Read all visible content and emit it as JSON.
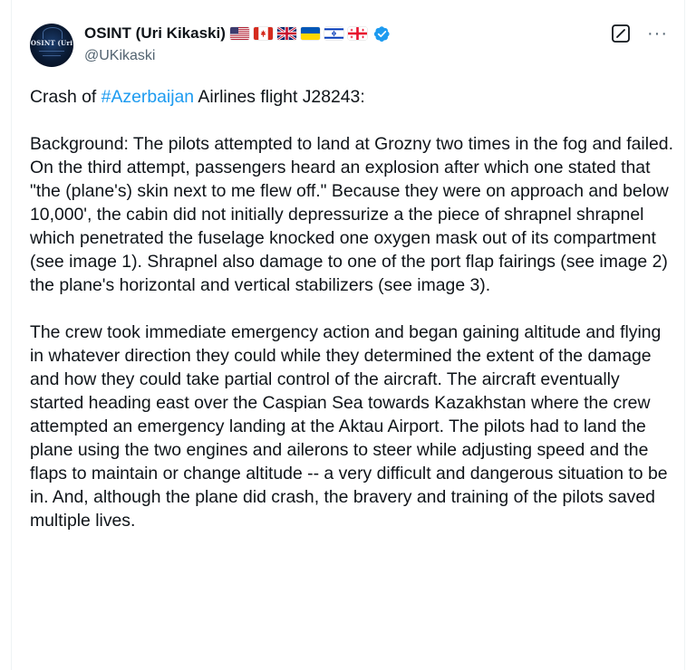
{
  "author": {
    "name": "OSINT (Uri Kikaski)",
    "handle": "@UKikaski",
    "avatar_text": "OSINT (Uri",
    "flags": [
      "us-flag",
      "canada-flag",
      "uk-flag",
      "ukraine-flag",
      "israel-flag",
      "georgia-flag"
    ],
    "verified_icon": "verified-badge-icon"
  },
  "actions": {
    "grok_icon": "grok-icon",
    "more_label": "···"
  },
  "tweet": {
    "p1": {
      "before": "Crash of ",
      "hashtag": "#Azerbaijan",
      "after": " Airlines flight J28243:"
    },
    "p2": "Background: The pilots attempted to land at Grozny two times in the fog and failed. On the third attempt, passengers heard an explosion after which one stated that \"the (plane's) skin next to me flew off.\" Because they were on approach and below 10,000', the cabin did not initially depressurize a the piece of shrapnel shrapnel which penetrated the fuselage knocked one oxygen mask out of its compartment (see image 1). Shrapnel also damage to one of the port flap fairings (see image 2) the plane's horizontal and vertical stabilizers (see image 3).",
    "p3": "The crew took immediate emergency action and began gaining altitude and flying in whatever direction they could while they determined the extent of the damage and how they could take partial control of the aircraft. The aircraft eventually started heading east over the Caspian Sea towards Kazakhstan where the crew attempted an emergency landing at the Aktau Airport. The pilots had to land the plane using the two engines and ailerons to steer while adjusting speed and the flaps to maintain or change altitude --  a very difficult and dangerous situation to be in. And, although the plane did crash, the bravery and training of the pilots saved multiple lives."
  },
  "colors": {
    "text": "#0f1419",
    "secondary": "#536471",
    "link": "#1d9bf0",
    "verified": "#1d9bf0"
  }
}
